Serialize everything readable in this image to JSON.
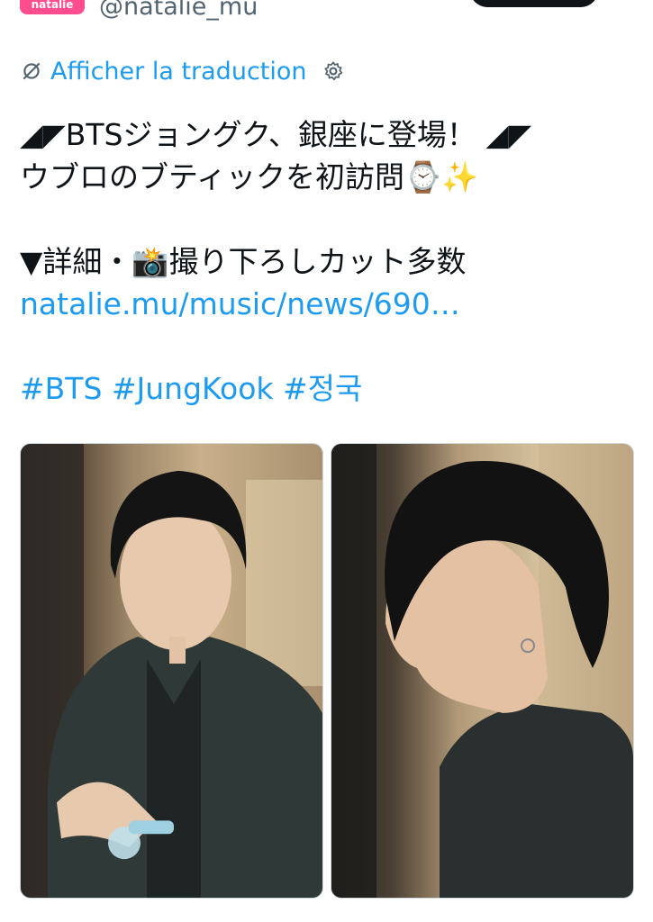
{
  "account": {
    "avatar_text": "natalie",
    "handle": "@natalie_mu"
  },
  "translation": {
    "link_label": "Afficher la traduction",
    "icon": "globe-off-icon",
    "settings_icon": "gear-icon"
  },
  "tweet": {
    "line1": "◢◤BTSジョングク、銀座に登場！ ◢◤",
    "line2": "ウブロのブティックを初訪問⌚✨",
    "line3": "▼詳細・📸撮り下ろしカット多数",
    "link": "natalie.mu/music/news/690…",
    "hashtags": "#BTS #JungKook #정국"
  },
  "media": {
    "count": 2,
    "photos": [
      "photo-front",
      "photo-profile"
    ]
  },
  "colors": {
    "link": "#1d9bf0",
    "text": "#0f1419",
    "muted": "#536471",
    "brand": "#ff4d8d"
  }
}
